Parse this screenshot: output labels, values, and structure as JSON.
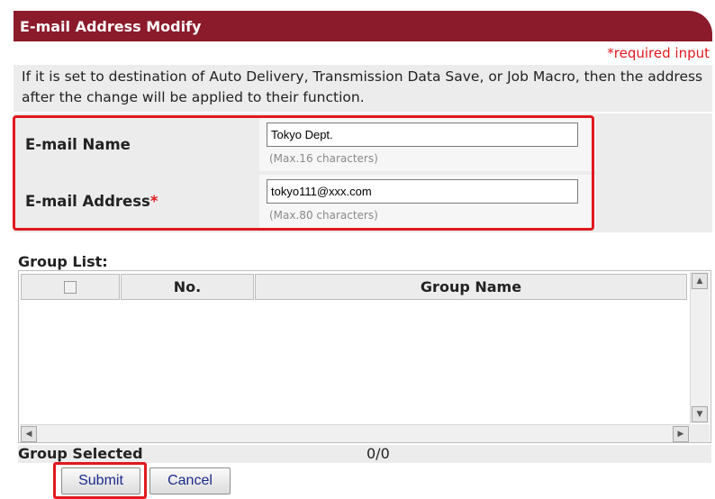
{
  "header": {
    "title": "E-mail Address Modify"
  },
  "required_note": "*required input",
  "info_text": "If it is set to destination of Auto Delivery, Transmission Data Save, or Job Macro, then the address after the change will be applied to their function.",
  "form": {
    "name": {
      "label": "E-mail Name",
      "value": "Tokyo Dept.",
      "hint": "(Max.16 characters)"
    },
    "address": {
      "label": "E-mail Address",
      "required_mark": "*",
      "value": "tokyo111@xxx.com",
      "hint": "(Max.80 characters)"
    }
  },
  "group_list": {
    "title": "Group List:",
    "columns": {
      "no": "No.",
      "name": "Group Name"
    },
    "rows": [],
    "selected_label": "Group Selected",
    "selected_count": "0/0"
  },
  "buttons": {
    "submit": "Submit",
    "cancel": "Cancel"
  },
  "colors": {
    "header_bg": "#8b1a2b",
    "required": "#e0191f",
    "highlight": "#e0191f",
    "panel_bg": "#ececec"
  }
}
